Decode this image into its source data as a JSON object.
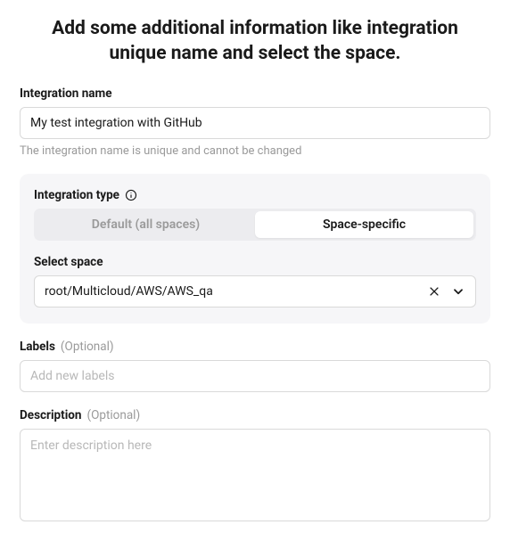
{
  "heading": "Add some additional information like integration unique name and select the space.",
  "integration_name": {
    "label": "Integration name",
    "value": "My test integration with GitHub",
    "help": "The integration name is unique and cannot be changed"
  },
  "integration_type": {
    "label": "Integration type",
    "options": {
      "default_label": "Default (all spaces)",
      "space_specific_label": "Space-specific"
    }
  },
  "select_space": {
    "label": "Select space",
    "value": "root/Multicloud/AWS/AWS_qa"
  },
  "labels_field": {
    "label": "Labels",
    "optional": "(Optional)",
    "placeholder": "Add new labels"
  },
  "description_field": {
    "label": "Description",
    "optional": "(Optional)",
    "placeholder": "Enter description here"
  }
}
